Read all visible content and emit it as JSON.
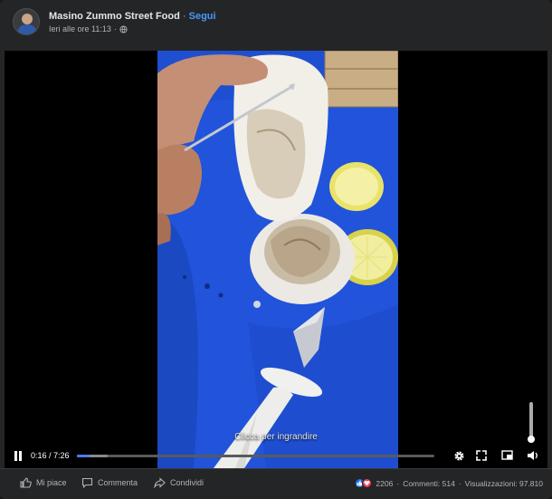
{
  "header": {
    "page_name": "Masino Zummo Street Food",
    "separator": " · ",
    "follow_label": "Segui",
    "timestamp": "Ieri alle ore 11:13",
    "dot": "·"
  },
  "video": {
    "caption": "Clicca per ingrandire",
    "current_time": "0:16",
    "duration": "7:26",
    "time_separator": " / ",
    "progress_fraction": 0.036,
    "buffer_fraction": 0.085
  },
  "icons": {
    "play_pause": "pause-icon",
    "settings": "gear-icon",
    "expand": "expand-icon",
    "pip": "picture-in-picture-icon",
    "volume": "volume-icon"
  },
  "footer": {
    "like_label": "Mi piace",
    "comment_label": "Commenta",
    "share_label": "Condividi",
    "reaction_count": "2206",
    "comments": "Commenti: 514",
    "views": "Visualizzazioni: 97.810",
    "dot": "·"
  },
  "colors": {
    "accent": "#4599ff",
    "progress": "#4a7bf0",
    "like": "#1877f2",
    "love": "#f33e58",
    "board": "#1f4fd1"
  }
}
